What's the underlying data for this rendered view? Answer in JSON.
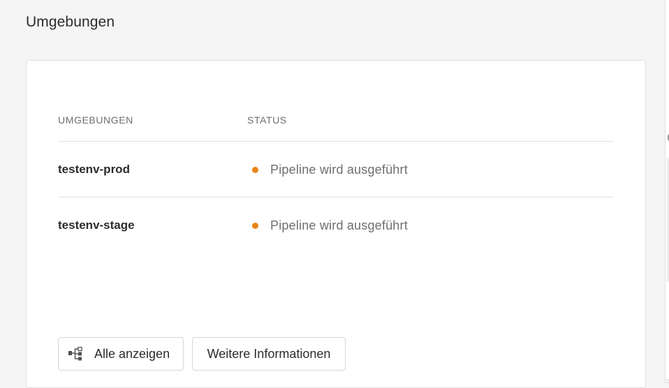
{
  "page": {
    "title": "Umgebungen"
  },
  "table": {
    "columns": [
      "UMGEBUNGEN",
      "STATUS"
    ],
    "rows": [
      {
        "name": "testenv-prod",
        "status": "Pipeline wird ausgeführt",
        "status_color": "#e68619"
      },
      {
        "name": "testenv-stage",
        "status": "Pipeline wird ausgeführt",
        "status_color": "#e68619"
      }
    ]
  },
  "buttons": {
    "show_all_label": "Alle anzeigen",
    "show_all_icon": "tree-view-icon",
    "more_info_label": "Weitere Informationen"
  }
}
